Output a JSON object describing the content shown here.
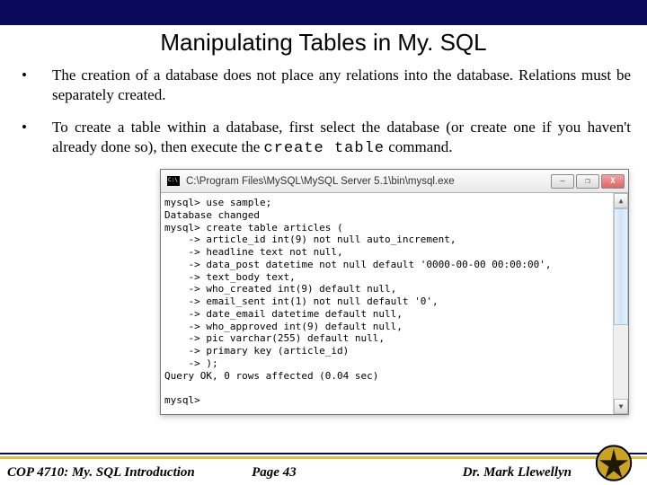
{
  "slide": {
    "title": "Manipulating Tables in My. SQL",
    "bullets": [
      "The creation of a database does not place any relations into the database. Relations must be separately created.",
      "To create a table within a database, first select the database (or create one if you haven't already done so), then execute the"
    ],
    "command_inline": "create table",
    "command_tail": "command."
  },
  "window": {
    "path": "C:\\Program Files\\MySQL\\MySQL Server 5.1\\bin\\mysql.exe",
    "buttons": {
      "min": "—",
      "max": "❐",
      "close": "X"
    },
    "scroll": {
      "up": "▲",
      "down": "▼"
    },
    "console": "mysql> use sample;\nDatabase changed\nmysql> create table articles (\n    -> article_id int(9) not null auto_increment,\n    -> headline text not null,\n    -> data_post datetime not null default '0000-00-00 00:00:00',\n    -> text_body text,\n    -> who_created int(9) default null,\n    -> email_sent int(1) not null default '0',\n    -> date_email datetime default null,\n    -> who_approved int(9) default null,\n    -> pic varchar(255) default null,\n    -> primary key (article_id)\n    -> );\nQuery OK, 0 rows affected (0.04 sec)\n\nmysql>"
  },
  "footer": {
    "left": "COP 4710: My. SQL Introduction",
    "center": "Page 43",
    "right": "Dr. Mark Llewellyn"
  }
}
